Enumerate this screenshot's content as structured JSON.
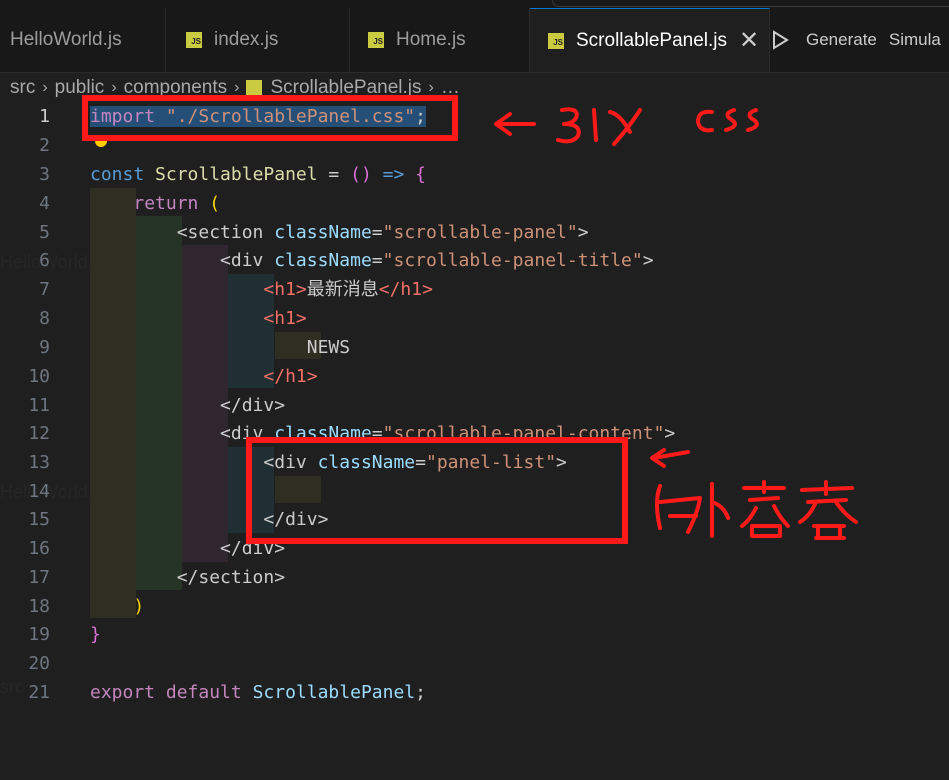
{
  "tabs": [
    {
      "label": "HelloWorld.js",
      "badge": "",
      "active": false
    },
    {
      "label": "index.js",
      "badge": "JS",
      "active": false
    },
    {
      "label": "Home.js",
      "badge": "JS",
      "active": false
    },
    {
      "label": "ScrollablePanel.js",
      "badge": "JS",
      "active": true
    }
  ],
  "actions": {
    "generate": "Generate",
    "simulate": "Simula"
  },
  "breadcrumb": [
    "src",
    "public",
    "components",
    "ScrollablePanel.js",
    "…"
  ],
  "line_numbers": [
    "1",
    "2",
    "3",
    "4",
    "5",
    "6",
    "7",
    "8",
    "9",
    "10",
    "11",
    "12",
    "13",
    "14",
    "15",
    "16",
    "17",
    "18",
    "19",
    "20",
    "21"
  ],
  "current_line": 1,
  "code": {
    "l1_kw": "import",
    "l1_str": "\"./ScrollablePanel.css\"",
    "l1_end": ";",
    "l3_kw": "const",
    "l3_name": "ScrollablePanel",
    "l3_eq": " = ",
    "l3_parens": "()",
    "l3_arrow": " => ",
    "l3_brace": "{",
    "l4_kw": "return",
    "l4_paren": "(",
    "l5_open": "<section",
    "l5_attr": "className",
    "l5_val": "\"scrollable-panel\"",
    "l5_close": ">",
    "l6_open": "<div",
    "l6_attr": "className",
    "l6_val": "\"scrollable-panel-title\"",
    "l6_close": ">",
    "l7_open": "<h1>",
    "l7_text": "最新消息",
    "l7_close": "</h1>",
    "l8_open": "<h1>",
    "l9_text": "NEWS",
    "l10_close": "</h1>",
    "l11_close": "</div>",
    "l12_open": "<div",
    "l12_attr": "className",
    "l12_val": "\"scrollable-panel-content\"",
    "l12_close": ">",
    "l13_open": "<div",
    "l13_attr": "className",
    "l13_val": "\"panel-list\"",
    "l13_close": ">",
    "l15_close": "</div>",
    "l16_close": "</div>",
    "l17_close": "</section>",
    "l18_paren": ")",
    "l19_brace": "}",
    "l21_kw1": "export",
    "l21_kw2": "default",
    "l21_name": "ScrollablePanel",
    "l21_end": ";"
  },
  "colors": {
    "annotation": "#ff1a1a",
    "keyword": "#569cd6",
    "control": "#c586c0",
    "string": "#ce9178",
    "attribute": "#9cdcfe",
    "selection": "#264f78"
  },
  "annotations": {
    "note1": "←31入css",
    "note2": "留下容器"
  }
}
